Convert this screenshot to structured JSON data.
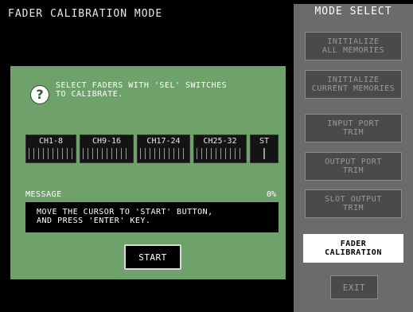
{
  "header": {
    "title": "FADER CALIBRATION MODE"
  },
  "mode_select": {
    "title": "MODE SELECT",
    "buttons": {
      "initialize_all": "INITIALIZE\nALL MEMORIES",
      "initialize_current": "INITIALIZE\nCURRENT MEMORIES",
      "input_port_trim": "INPUT PORT\nTRIM",
      "output_port_trim": "OUTPUT PORT\nTRIM",
      "slot_output_trim": "SLOT OUTPUT\nTRIM",
      "fader_calibration": "FADER\nCALIBRATION",
      "exit": "EXIT"
    },
    "selected": "fader_calibration"
  },
  "dialog": {
    "help_icon": "question-icon",
    "instruction": "SELECT FADERS WITH 'SEL' SWITCHES\nTO CALIBRATE.",
    "fader_groups": [
      "CH1-8",
      "CH9-16",
      "CH17-24",
      "CH25-32",
      "ST"
    ],
    "message_label": "MESSAGE",
    "progress": "0%",
    "message": "MOVE THE CURSOR TO 'START' BUTTON,\nAND PRESS 'ENTER' KEY.",
    "start_label": "START"
  },
  "colors": {
    "dialog_bg": "#6fa26a",
    "panel_bg": "#6b6b6b",
    "selected_button": "#ffffff"
  }
}
